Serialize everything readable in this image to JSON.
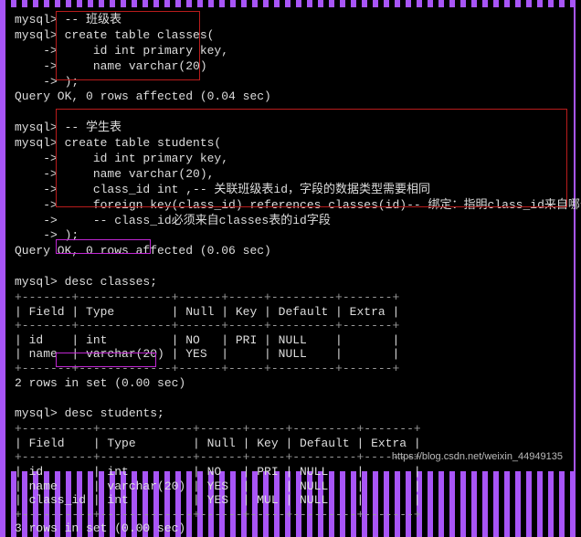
{
  "block1": {
    "l1": "mysql> -- 班级表",
    "l2": "mysql> create table classes(",
    "l3": "    ->     id int primary key,",
    "l4": "    ->     name varchar(20)",
    "l5": "    -> );",
    "result": "Query OK, 0 rows affected (0.04 sec)"
  },
  "block2": {
    "l1": "mysql> -- 学生表",
    "l2": "mysql> create table students(",
    "l3": "    ->     id int primary key,",
    "l4": "    ->     name varchar(20),",
    "l5": "    ->     class_id int ,-- 关联班级表id，字段的数据类型需要相同",
    "l6": "    ->     foreign key(class_id) references classes(id)-- 绑定：指明class_id来自哪个表",
    "l7": "    ->     -- class_id必须来自classes表的id字段",
    "l8": "    -> );",
    "result": "Query OK, 0 rows affected (0.06 sec)"
  },
  "desc1": {
    "cmd": "mysql> desc classes;",
    "sep": "+-------+-------------+------+-----+---------+-------+",
    "hdr": "| Field | Type        | Null | Key | Default | Extra |",
    "r1": "| id    | int         | NO   | PRI | NULL    |       |",
    "r2": "| name  | varchar(20) | YES  |     | NULL    |       |",
    "result": "2 rows in set (0.00 sec)"
  },
  "desc2": {
    "cmd": "mysql> desc students;",
    "sep": "+----------+-------------+------+-----+---------+-------+",
    "hdr": "| Field    | Type        | Null | Key | Default | Extra |",
    "r1": "| id       | int         | NO   | PRI | NULL    |       |",
    "r2": "| name     | varchar(20) | YES  |     | NULL    |       |",
    "r3": "| class_id | int         | YES  | MUL | NULL    |       |",
    "result": "3 rows in set (0.00 sec)"
  },
  "watermark": "https://blog.csdn.net/weixin_44949135"
}
